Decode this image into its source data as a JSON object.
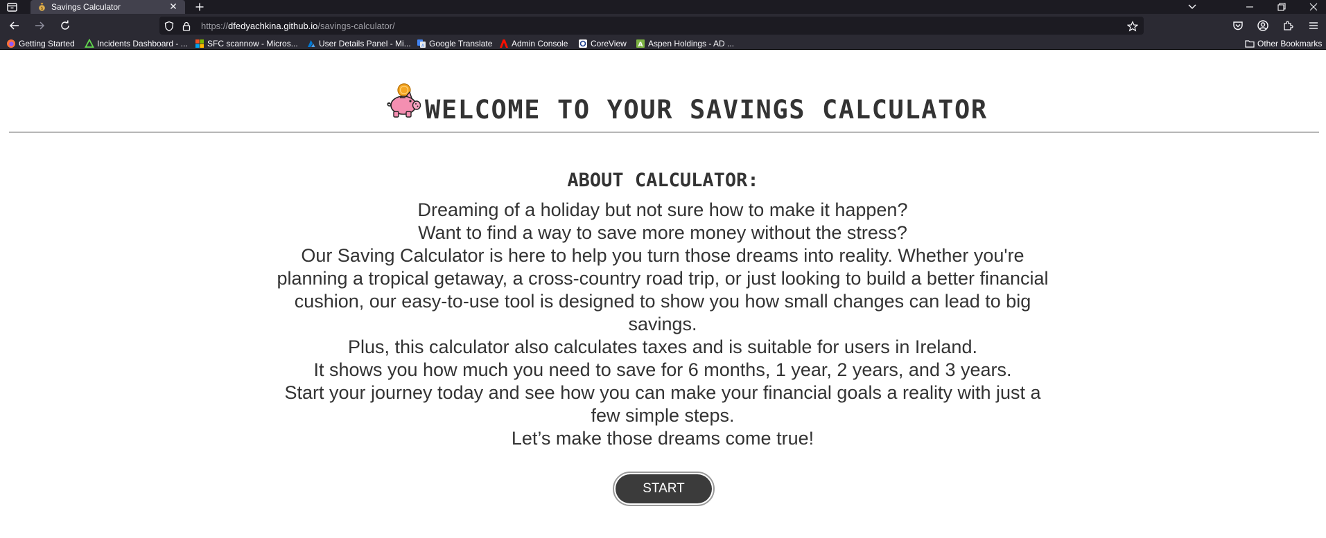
{
  "browser": {
    "tab": {
      "title": "Savings Calculator"
    },
    "url": {
      "prefix": "https://",
      "host": "dfedyachkina.github.io",
      "path": "/savings-calculator/"
    },
    "bookmarks": [
      {
        "label": "Getting Started",
        "icon": "firefox-icon",
        "color": "#ff7139"
      },
      {
        "label": "Incidents Dashboard - ...",
        "icon": "servicenow-icon",
        "color": "#62d84e"
      },
      {
        "label": "SFC scannow - Micros...",
        "icon": "microsoft-icon",
        "color": "#f25022"
      },
      {
        "label": "User Details Panel - Mi...",
        "icon": "azure-icon",
        "color": "#0078d4"
      },
      {
        "label": "Google Translate",
        "icon": "google-translate-icon",
        "color": "#4285f4"
      },
      {
        "label": "Admin Console",
        "icon": "adobe-icon",
        "color": "#fa0f00"
      },
      {
        "label": "CoreView",
        "icon": "coreview-icon",
        "color": "#ffffff"
      },
      {
        "label": "Aspen Holdings - AD ...",
        "icon": "aspen-icon",
        "color": "#7cb342"
      }
    ],
    "other_bookmarks": "Other Bookmarks"
  },
  "page": {
    "title": "WELCOME TO YOUR SAVINGS CALCULATOR",
    "about_heading": "ABOUT CALCULATOR:",
    "about_paragraphs": [
      "Dreaming of a holiday but not sure how to make it happen?",
      "Want to find a way to save more money without the stress?",
      "Our Saving Calculator is here to help you turn those dreams into reality. Whether you're planning a tropical getaway, a cross-country road trip, or just looking to build a better financial cushion, our easy-to-use tool is designed to show you how small changes can lead to big savings.",
      "Plus, this calculator also calculates taxes and is suitable for users in Ireland.",
      "It shows you how much you need to save for 6 months, 1 year, 2 years, and 3 years.",
      "Start your journey today and see how you can make your financial goals a reality with just a few simple steps.",
      "Let’s make those dreams come true!"
    ],
    "start_label": "START"
  },
  "colors": {
    "text": "#333333",
    "button_bg": "#3b3b3b",
    "pig": "#f48fb1",
    "coin": "#f5a623"
  }
}
